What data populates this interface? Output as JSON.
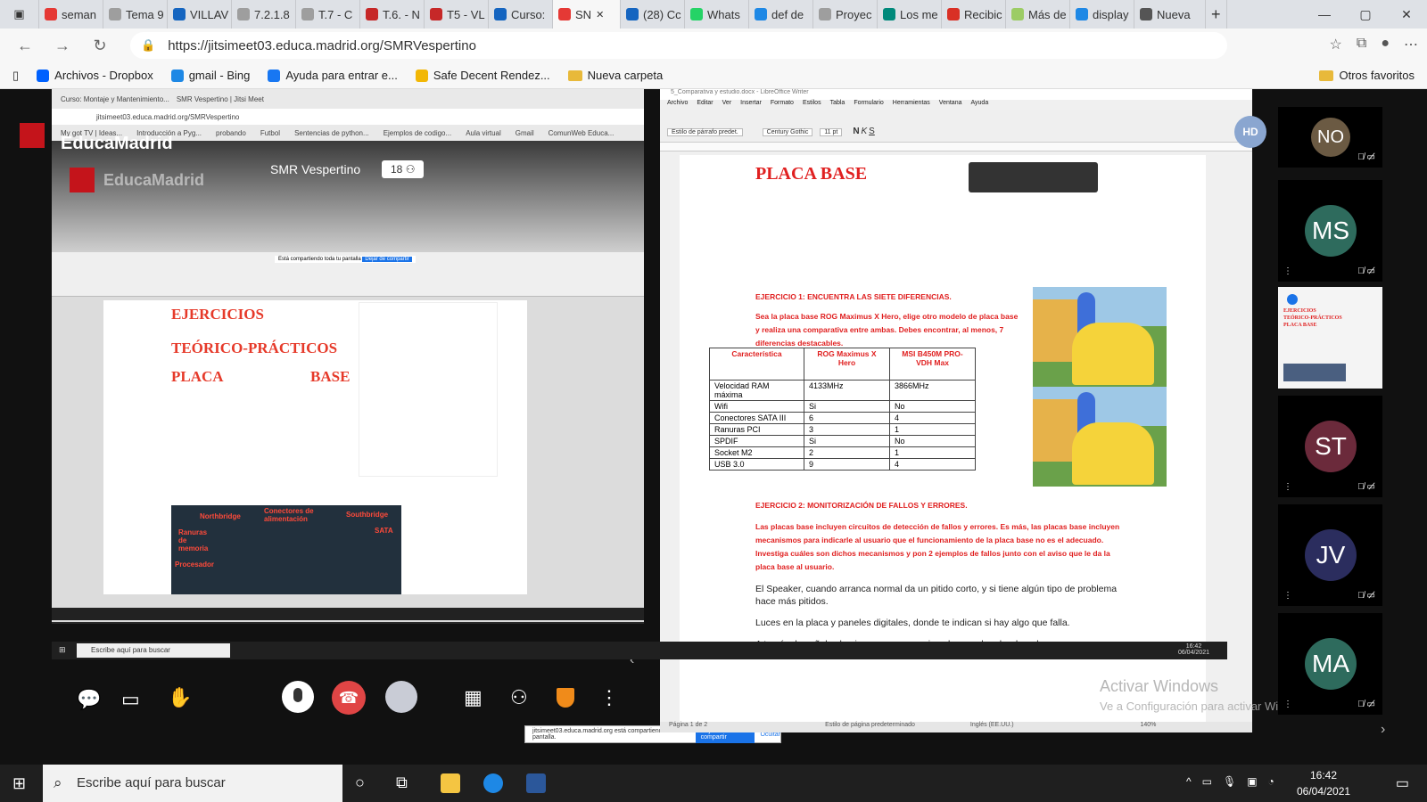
{
  "browser": {
    "tabs": [
      {
        "label": "seman",
        "color": "#e53935"
      },
      {
        "label": "Tema 9",
        "color": "#9e9e9e"
      },
      {
        "label": "VILLAV",
        "color": "#1565c0"
      },
      {
        "label": "7.2.1.8",
        "color": "#9e9e9e"
      },
      {
        "label": "T.7 - C",
        "color": "#9e9e9e"
      },
      {
        "label": "T.6. - N",
        "color": "#c62828"
      },
      {
        "label": "T5 - VL",
        "color": "#c62828"
      },
      {
        "label": "Curso:",
        "color": "#1565c0"
      },
      {
        "label": "SN",
        "color": "#e53935",
        "active": true
      },
      {
        "label": "(28) Cc",
        "color": "#1565c0"
      },
      {
        "label": "Whats",
        "color": "#25d366"
      },
      {
        "label": "def de",
        "color": "#1e88e5"
      },
      {
        "label": "Proyec",
        "color": "#9e9e9e"
      },
      {
        "label": "Los me",
        "color": "#00897b"
      },
      {
        "label": "Recibic",
        "color": "#d93025"
      },
      {
        "label": "Más de",
        "color": "#9ccc65"
      },
      {
        "label": "display",
        "color": "#1e88e5"
      },
      {
        "label": "Nueva",
        "color": "#555555"
      }
    ],
    "url": "https://jitsimeet03.educa.madrid.org/SMRVespertino",
    "bookmarks": [
      {
        "label": "Archivos - Dropbox"
      },
      {
        "label": "gmail - Bing"
      },
      {
        "label": "Ayuda para entrar e..."
      },
      {
        "label": "Safe Decent Rendez..."
      },
      {
        "label": "Nueva carpeta"
      }
    ],
    "other_favorites": "Otros favoritos"
  },
  "meeting": {
    "brand": "EducaMadrid",
    "room": "SMR Vespertino",
    "participant_count": "18"
  },
  "inner_browser": {
    "tab1": "Curso: Montaje y Mantenimiento...",
    "tab2": "SMR Vespertino | Jitsi Meet",
    "url": "jitsimeet03.educa.madrid.org/SMRVespertino",
    "bookmarks": [
      "My got TV | Ideas...",
      "Introducción a Pyg...",
      "probando",
      "Futbol",
      "Sentencias de python...",
      "Ejemplos de codigo...",
      "Aula virtual",
      "Gmail",
      "ComunWeb Educa..."
    ]
  },
  "inner_doc": {
    "line1": "EJERCICIOS",
    "line2": "TEÓRICO-PRÁCTICOS",
    "line3a": "PLACA",
    "line3b": "BASE",
    "labels": [
      "Northbridge",
      "Conectores de alimentación",
      "Southbridge",
      "Ranuras de memoria",
      "SATA",
      "Procesador"
    ],
    "share_bar": "Está compartiendo toda tu pantalla",
    "stop_label": "Dejar de compartir"
  },
  "writer": {
    "title": "5_Comparativa y estudio.docx - LibreOffice Writer",
    "menu": [
      "Archivo",
      "Editar",
      "Ver",
      "Insertar",
      "Formato",
      "Estilos",
      "Tabla",
      "Formulario",
      "Herramientas",
      "Ventana",
      "Ayuda"
    ],
    "style_box": "Estilo de párrafo predet.",
    "font_box": "Century Gothic",
    "size_box": "11 pt",
    "doc_title": "PLACA BASE",
    "ex1_title": "EJERCICIO 1: ENCUENTRA LAS SIETE DIFERENCIAS.",
    "ex1_text": "Sea la placa base ROG Maximus X Hero, elige otro modelo de placa base y realiza una comparativa entre ambas. Debes encontrar, al menos, 7 diferencias destacables.",
    "table": {
      "headers": [
        "Característica",
        "ROG Maximus X Hero",
        "MSI B450M PRO-VDH Max"
      ],
      "rows": [
        [
          "Velocidad RAM máxima",
          "4133MHz",
          "3866MHz"
        ],
        [
          "Wifi",
          "Si",
          "No"
        ],
        [
          "Conectores SATA III",
          "6",
          "4"
        ],
        [
          "Ranuras PCI",
          "3",
          "1"
        ],
        [
          "SPDIF",
          "Si",
          "No"
        ],
        [
          "Socket M2",
          "2",
          "1"
        ],
        [
          "USB 3.0",
          "9",
          "4"
        ]
      ]
    },
    "ex2_title": "EJERCICIO 2: MONITORIZACIÓN DE FALLOS Y ERRORES.",
    "ex2_text": "Las placas base incluyen circuitos de detección de fallos y errores. Es más, las placas base incluyen mecanismos para indicarle al usuario que el funcionamiento de la placa base no es el adecuado. Investiga cuáles son dichos mecanismos y pon 2 ejemplos de fallos junto con el aviso que le da la placa base al usuario.",
    "answer1": "El Speaker, cuando arranca normal da un pitido corto, y si tiene algún tipo de problema hace más pitidos.",
    "answer2": "Luces en la placa y paneles digitales, donde te indican si hay algo que falla.",
    "answer3": "A través de señales luminosas, en mensajes al encender el ordenador.",
    "status_left": "Página 1 de 2",
    "status_style": "Estilo de página predeterminado",
    "status_lang": "Inglés (EE.UU.)",
    "zoom": "140%"
  },
  "share_notice": {
    "text": "jitsimeet03.educa.madrid.org está compartiendo tu pantalla.",
    "stop": "Dejar de compartir",
    "hide": "Ocultar"
  },
  "watermark": {
    "line1": "Activar Windows",
    "line2": "Ve a Configuración para activar Windows."
  },
  "participants": [
    {
      "initials": "HD",
      "color": "#8aa6d0"
    },
    {
      "initials": "NO",
      "color": "#6b5a43"
    },
    {
      "initials": "MS",
      "color": "#2e6b5d"
    },
    {
      "initials": "ST",
      "color": "#6b2a3b"
    },
    {
      "initials": "JV",
      "color": "#2b2d5e"
    },
    {
      "initials": "MA",
      "color": "#2e6b5d"
    }
  ],
  "screen_thumb": {
    "line1": "EJERCICIOS",
    "line2": "TEÓRICO-PRÁCTICOS",
    "line3": "PLACA          BASE"
  },
  "inner_taskbar": {
    "search": "Escribe aquí para buscar",
    "time": "16:42",
    "date": "06/04/2021"
  },
  "taskbar": {
    "search": "Escribe aquí para buscar",
    "time": "16:42",
    "date": "06/04/2021"
  }
}
